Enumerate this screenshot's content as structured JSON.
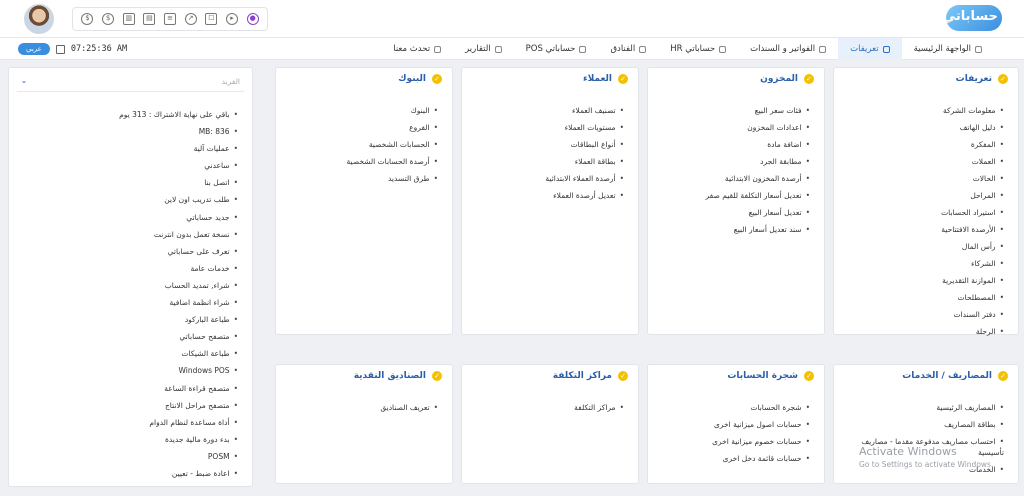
{
  "header": {
    "logo_text": "حساباتي",
    "tray_icons": [
      "dollar-icon",
      "money-bag-icon",
      "bar-chart-icon",
      "printer-icon",
      "database-icon",
      "rocket-icon",
      "android-icon",
      "play-icon",
      "user-lock-icon"
    ]
  },
  "nav": {
    "items": [
      {
        "label": "الواجهة الرئيسية",
        "icon": "home-icon"
      },
      {
        "label": "تعريفات",
        "icon": "eye-icon",
        "active": true
      },
      {
        "label": "الفواتير و السندات",
        "icon": "invoice-icon"
      },
      {
        "label": "حساباتي HR",
        "icon": "hr-icon"
      },
      {
        "label": "الفنادق",
        "icon": "hotel-icon"
      },
      {
        "label": "حساباتي POS",
        "icon": "pos-icon"
      },
      {
        "label": "التقارير",
        "icon": "report-icon"
      },
      {
        "label": "تحدث معنا",
        "icon": "chat-icon"
      }
    ],
    "time": "07:25:36 AM",
    "lang_label": "عربي"
  },
  "cards": {
    "definitions": {
      "title": "تعريفات",
      "items": [
        "معلومات الشركة",
        "دليل الهاتف",
        "المفكرة",
        "العملات",
        "الحالات",
        "المراحل",
        "استيراد الحسابات",
        "الأرصدة الافتتاحية",
        "رأس المال",
        "الشركاء",
        "الموازنة التقديرية",
        "المصطلحات",
        "دفتر السندات",
        "الرحلة"
      ]
    },
    "warehouse": {
      "title": "المخزون",
      "items": [
        "فئات سعر البيع",
        "اعدادات المخزون",
        "اضافة مادة",
        "مطابقة الجرد",
        "أرصدة المخزون الابتدائية",
        "تعديل أسعار التكلفة للقيم صفر",
        "تعديل أسعار البيع",
        "سند تعديل أسعار البيع"
      ]
    },
    "customers": {
      "title": "العملاء",
      "items": [
        "تصنيف العملاء",
        "مستويات العملاء",
        "أنواع البطاقات",
        "بطاقة العملاء",
        "أرصدة العملاء الابتدائية",
        "تعديل أرصدة العملاء"
      ]
    },
    "banks": {
      "title": "البنوك",
      "items": [
        "البنوك",
        "الفروع",
        "الحسابات الشخصية",
        "أرصدة الحسابات الشخصية",
        "طرق التسديد"
      ]
    },
    "expenses": {
      "title": "المصاريف / الخدمات",
      "items": [
        "المصاريف الرئيسية",
        "بطاقة المصاريف",
        "احتساب مصاريف مدفوعة مقدما - مصاريف تأسيسية",
        "الخدمات"
      ]
    },
    "accounts_tree": {
      "title": "شجرة الحسابات",
      "items": [
        "شجرة الحسابات",
        "حسابات اصول ميزانية اخرى",
        "حسابات خصوم ميزانية اخرى",
        "حسابات قائمة دخل اخرى"
      ]
    },
    "cost_centers": {
      "title": "مراكز التكلفة",
      "items": [
        "مراكز التكلفة"
      ]
    },
    "cash_boxes": {
      "title": "الصناديق النقدية",
      "items": [
        "تعريف الصناديق"
      ]
    }
  },
  "side_panel": {
    "search_label": "الفريد",
    "items": [
      "باقي على نهاية الاشتراك : 313 يوم",
      "836 :MB",
      "عمليات آلية",
      "ساعدني",
      "اتصل بنا",
      "طلب تدريب اون لاين",
      "جديد حساباتي",
      "نسخة تعمل بدون انترنت",
      "تعرف على حساباتي",
      "خدمات عامة",
      "شراء, تمديد الحساب",
      "شراء انظمة اضافية",
      "طباعة الباركود",
      "متصفح حساباتي",
      "طباعة الشيكات",
      "Windows POS",
      "متصفح قراءة الساعة",
      "متصفح مراحل الانتاج",
      "أداة مساعدة لنظام الدوام",
      "بدء دورة مالية جديدة",
      "POSM",
      "اعادة ضبط - تعيين"
    ]
  },
  "watermark": {
    "line1": "Activate Windows",
    "line2": "Go to Settings to activate Windows."
  }
}
